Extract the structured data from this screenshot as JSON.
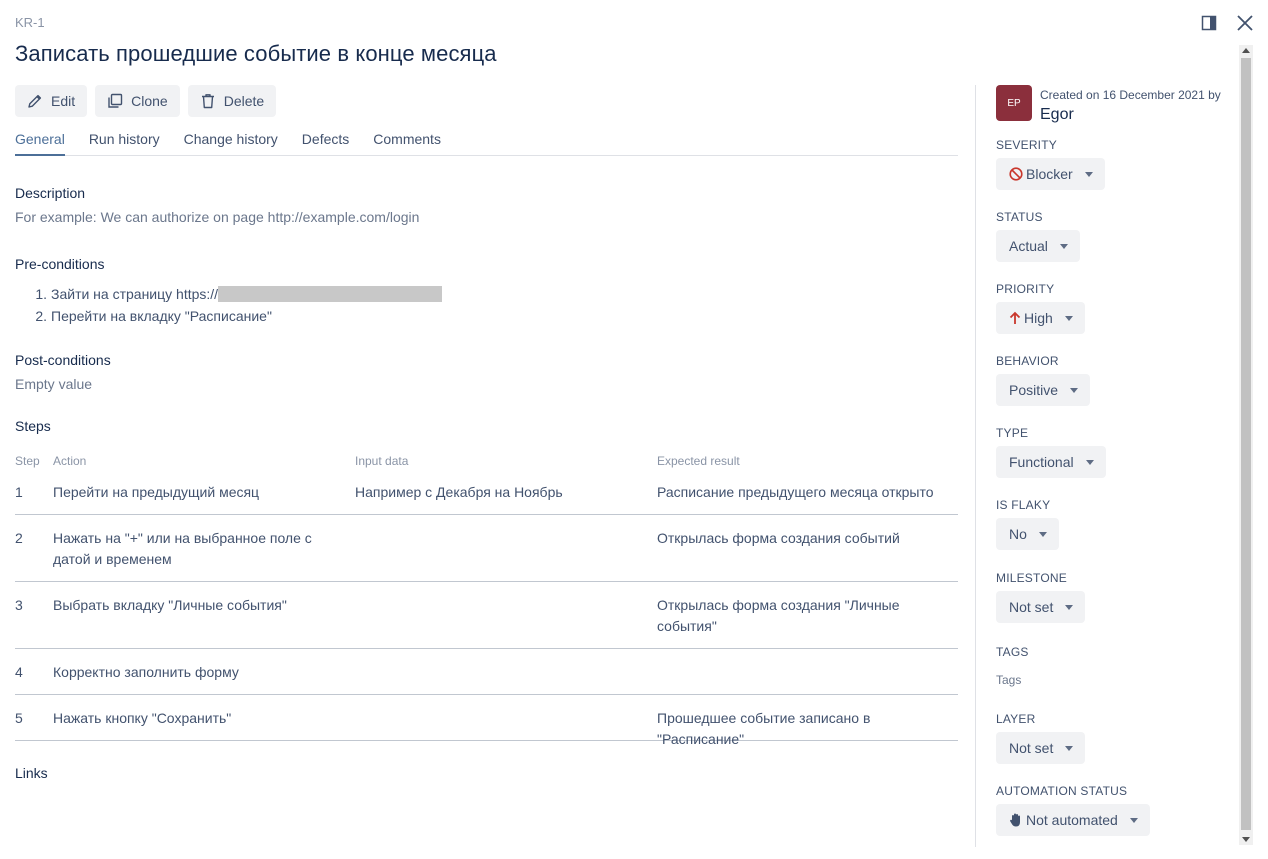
{
  "header": {
    "issue_key": "KR-1",
    "title": "Записать прошедшие событие в конце месяца",
    "icons": [
      "side-panel-icon",
      "close-icon"
    ]
  },
  "toolbar": {
    "edit_label": "Edit",
    "clone_label": "Clone",
    "delete_label": "Delete"
  },
  "tabs": [
    {
      "label": "General",
      "active": true
    },
    {
      "label": "Run history"
    },
    {
      "label": "Change history"
    },
    {
      "label": "Defects"
    },
    {
      "label": "Comments"
    }
  ],
  "description": {
    "label": "Description",
    "value": "For example: We can authorize on page http://example.com/login"
  },
  "preconditions": {
    "label": "Pre-conditions",
    "items": [
      {
        "num": "1.",
        "text": "Зайти на страницу https://"
      },
      {
        "num": "2.",
        "text": "Перейти на вкладку \"Расписание\""
      }
    ]
  },
  "postconditions": {
    "label": "Post-conditions",
    "value": "Empty value"
  },
  "steps": {
    "label": "Steps",
    "columns": [
      "Step",
      "Action",
      "Input data",
      "Expected result"
    ],
    "rows": [
      {
        "step": "1",
        "action": "Перейти на предыдущий месяц",
        "input": "Например с Декабря на Ноябрь",
        "expected": "Расписание предыдущего месяца открыто"
      },
      {
        "step": "2",
        "action": "Нажать на \"+\" или на выбранное поле с датой и временем",
        "input": "",
        "expected": "Открылась форма создания событий"
      },
      {
        "step": "3",
        "action": "Выбрать вкладку \"Личные события\"",
        "input": "",
        "expected": "Открылась форма создания \"Личные события\""
      },
      {
        "step": "4",
        "action": "Корректно заполнить форму",
        "input": "",
        "expected": ""
      },
      {
        "step": "5",
        "action": "Нажать кнопку \"Сохранить\"",
        "input": "",
        "expected": "Прошедшее событие записано в \"Расписание\""
      }
    ]
  },
  "links": {
    "label": "Links"
  },
  "sidebar": {
    "avatar_initials": "EP",
    "avatar_color": "#8b2f3c",
    "created_text": "Created on 16 December 2021 by",
    "creator": "Egor",
    "fields": {
      "severity": {
        "label": "SEVERITY",
        "value": "Blocker",
        "icon": "blocker-icon",
        "icon_color": "#c9372c"
      },
      "status": {
        "label": "STATUS",
        "value": "Actual"
      },
      "priority": {
        "label": "PRIORITY",
        "value": "High",
        "icon": "arrow-up-icon",
        "icon_color": "#c9372c"
      },
      "behavior": {
        "label": "BEHAVIOR",
        "value": "Positive"
      },
      "type": {
        "label": "TYPE",
        "value": "Functional"
      },
      "is_flaky": {
        "label": "IS FLAKY",
        "value": "No"
      },
      "milestone": {
        "label": "MILESTONE",
        "value": "Not set"
      },
      "tags": {
        "label": "TAGS",
        "value": "Tags"
      },
      "layer": {
        "label": "LAYER",
        "value": "Not set"
      },
      "automation_status": {
        "label": "AUTOMATION STATUS",
        "value": "Not automated",
        "icon": "hand-icon"
      }
    }
  },
  "colors": {
    "accent": "#4c6f98",
    "text": "#172b4d",
    "muted": "#6b778c",
    "button_bg": "#f1f2f4"
  }
}
